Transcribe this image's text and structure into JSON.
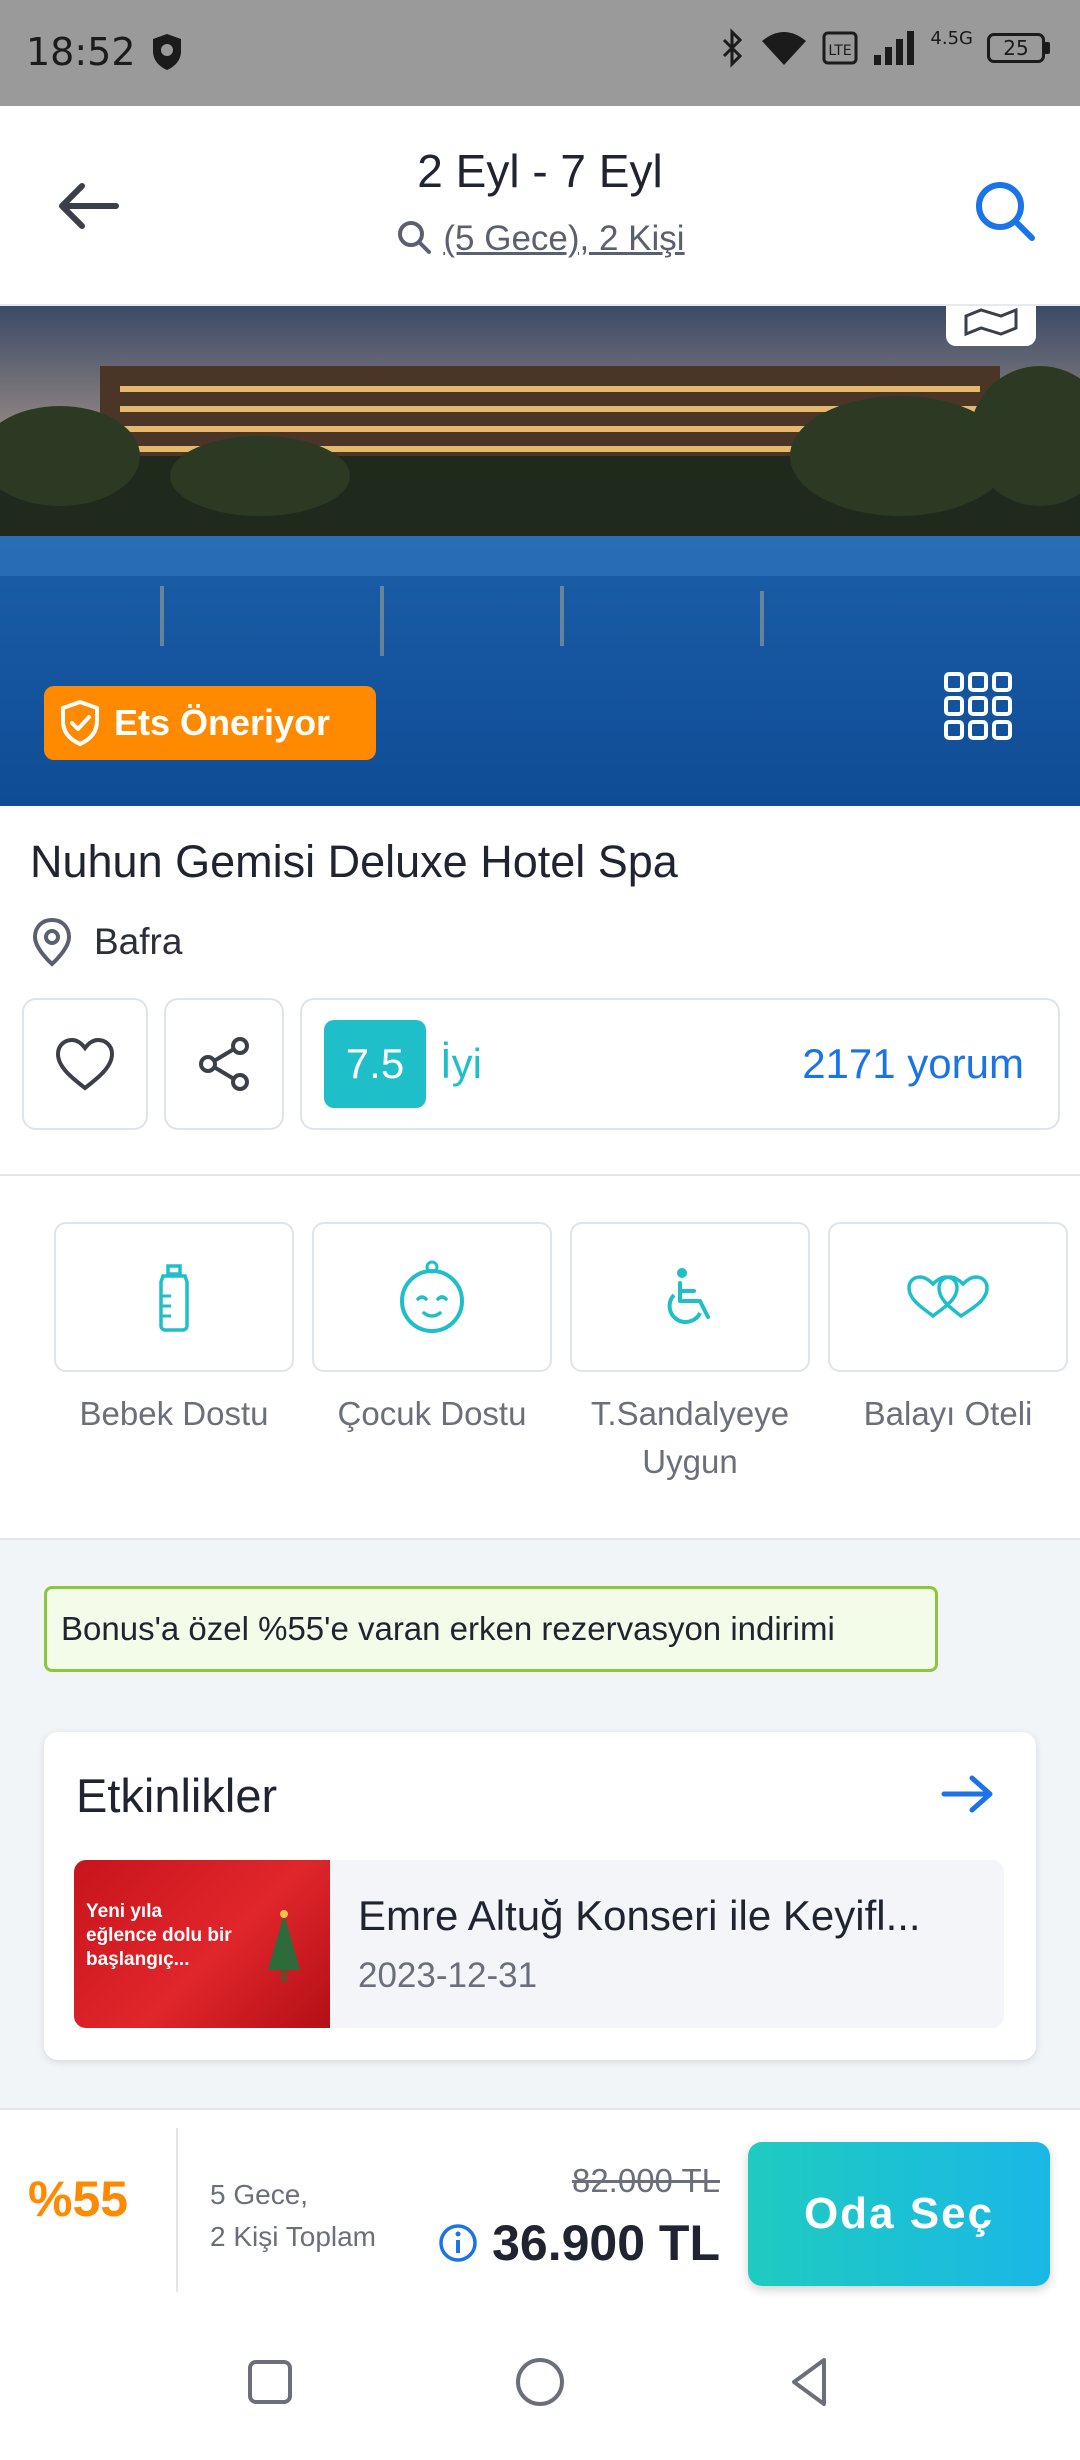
{
  "status_bar": {
    "time": "18:52",
    "network": "4.5G",
    "battery": "25"
  },
  "header": {
    "title": "2 Eyl - 7 Eyl",
    "subtitle": "(5 Gece), 2 Kişi"
  },
  "hero": {
    "badge": "Ets Öneriyor"
  },
  "hotel": {
    "name": "Nuhun Gemisi Deluxe Hotel Spa",
    "location": "Bafra",
    "score": "7.5",
    "score_label": "İyi",
    "reviews": "2171 yorum"
  },
  "features": [
    {
      "label": "Bebek Dostu",
      "icon": "baby-bottle-icon"
    },
    {
      "label": "Çocuk Dostu",
      "icon": "child-face-icon"
    },
    {
      "label": "T.Sandalyeye Uygun",
      "icon": "wheelchair-icon"
    },
    {
      "label": "Balayı Oteli",
      "icon": "hearts-icon"
    }
  ],
  "promo": "Bonus'a özel %55'e varan erken rezervasyon indirimi",
  "events": {
    "title": "Etkinlikler",
    "items": [
      {
        "name": "Emre Altuğ Konseri ile Keyifl...",
        "date": "2023-12-31",
        "thumb_text": "Yeni yıla eğlence dolu bir başlangıç..."
      }
    ]
  },
  "booking": {
    "discount": "%55",
    "nights": "5 Gece,",
    "guests": "2 Kişi Toplam",
    "old_price": "82.000 TL",
    "new_price": "36.900 TL",
    "cta": "Oda Seç"
  },
  "colors": {
    "accent": "#1a73e8",
    "teal": "#1fbfc9",
    "orange": "#ff8a00",
    "promo_border": "#8cc63f"
  }
}
